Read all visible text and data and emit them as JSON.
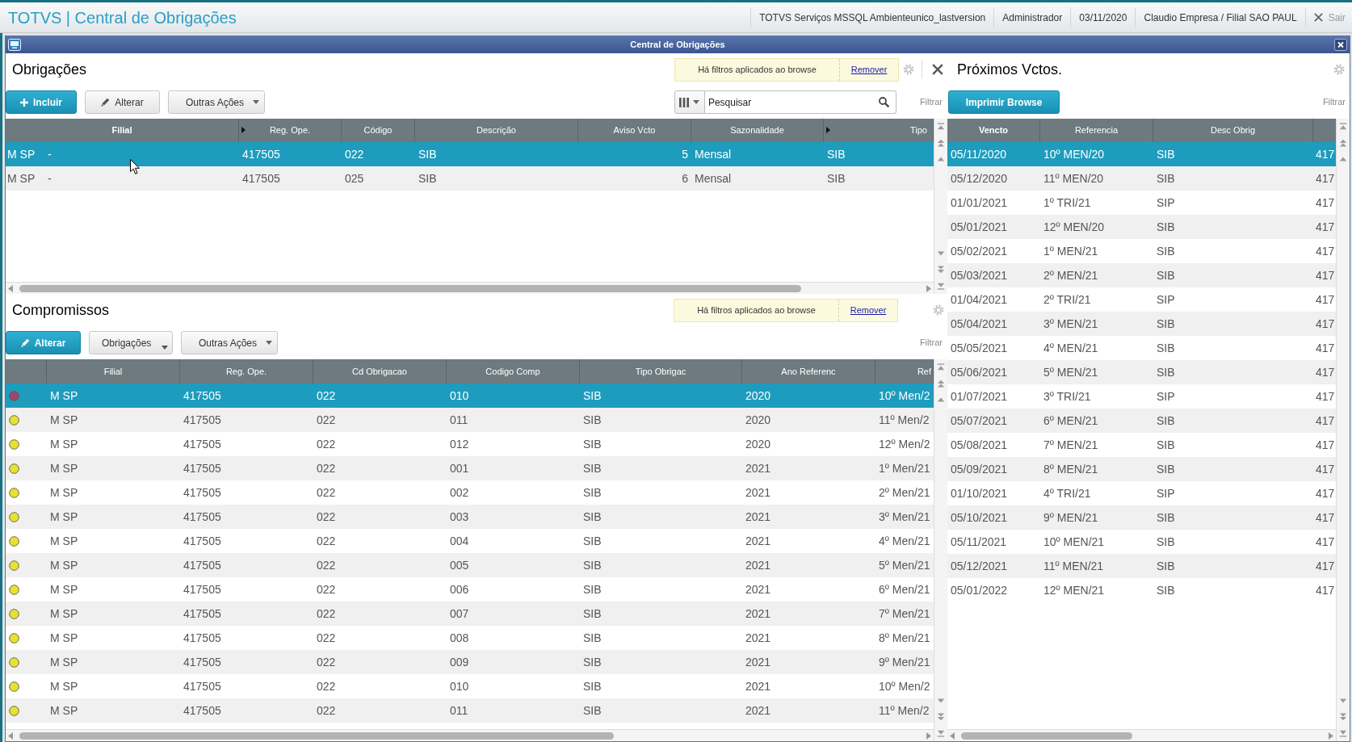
{
  "app_bar": {
    "title": "TOTVS | Central de Obrigações",
    "info": [
      "TOTVS Serviços MSSQL Ambienteunico_lastversion",
      "Administrador",
      "03/11/2020",
      "Claudio Empresa / Filial SAO PAUL"
    ],
    "exit": "Sair"
  },
  "window": {
    "title": "Central de Obrigações"
  },
  "obrigacoes": {
    "title": "Obrigações",
    "filter_notice": {
      "text": "Há filtros aplicados ao browse",
      "link": "Remover"
    },
    "buttons": [
      {
        "label": "Incluir",
        "kind": "add",
        "primary": true
      },
      {
        "label": "Alterar",
        "kind": "edit",
        "primary": false
      },
      {
        "label": "Outras Ações",
        "kind": "menu",
        "primary": false
      }
    ],
    "search": {
      "placeholder": "Pesquisar"
    },
    "filter_label": "Filtrar",
    "table": {
      "columns": [
        {
          "label": "Filial",
          "sorted": true,
          "arrow": false
        },
        {
          "label": "Reg. Ope.",
          "sorted": false,
          "arrow": true
        },
        {
          "label": "Código",
          "sorted": false,
          "arrow": false
        },
        {
          "label": "Descrição",
          "sorted": false,
          "arrow": false
        },
        {
          "label": "Aviso Vcto",
          "sorted": false,
          "arrow": false
        },
        {
          "label": "Sazonalidade",
          "sorted": false,
          "arrow": false
        },
        {
          "label": "Tipo",
          "sorted": false,
          "arrow": true
        }
      ],
      "rows": [
        {
          "selected": true,
          "cells": [
            [
              "M SP",
              "-"
            ],
            "417505",
            "022",
            "SIB",
            "5",
            "Mensal",
            "SIB"
          ]
        },
        {
          "selected": false,
          "cells": [
            [
              "M SP",
              "-"
            ],
            "417505",
            "025",
            "SIB",
            "6",
            "Mensal",
            "SIB"
          ]
        }
      ]
    }
  },
  "proximos_vctos": {
    "title": "Próximos Vctos.",
    "buttons": [
      {
        "label": "Imprimir Browse",
        "kind": "plain",
        "primary": true
      }
    ],
    "filter_label": "Filtrar",
    "table": {
      "columns": [
        {
          "label": "Vencto",
          "sorted": true
        },
        {
          "label": "Referencia",
          "sorted": false
        },
        {
          "label": "Desc Obrig",
          "sorted": false
        }
      ],
      "rows": [
        {
          "selected": true,
          "cells": [
            "05/11/2020",
            "10º MEN/20",
            "SIB",
            "417"
          ]
        },
        {
          "selected": false,
          "cells": [
            "05/12/2020",
            "11º MEN/20",
            "SIB",
            "417"
          ]
        },
        {
          "selected": false,
          "cells": [
            "01/01/2021",
            "1º TRI/21",
            "SIP",
            "417"
          ]
        },
        {
          "selected": false,
          "cells": [
            "05/01/2021",
            "12º MEN/20",
            "SIB",
            "417"
          ]
        },
        {
          "selected": false,
          "cells": [
            "05/02/2021",
            "1º MEN/21",
            "SIB",
            "417"
          ]
        },
        {
          "selected": false,
          "cells": [
            "05/03/2021",
            "2º MEN/21",
            "SIB",
            "417"
          ]
        },
        {
          "selected": false,
          "cells": [
            "01/04/2021",
            "2º TRI/21",
            "SIP",
            "417"
          ]
        },
        {
          "selected": false,
          "cells": [
            "05/04/2021",
            "3º MEN/21",
            "SIB",
            "417"
          ]
        },
        {
          "selected": false,
          "cells": [
            "05/05/2021",
            "4º MEN/21",
            "SIB",
            "417"
          ]
        },
        {
          "selected": false,
          "cells": [
            "05/06/2021",
            "5º MEN/21",
            "SIB",
            "417"
          ]
        },
        {
          "selected": false,
          "cells": [
            "01/07/2021",
            "3º TRI/21",
            "SIP",
            "417"
          ]
        },
        {
          "selected": false,
          "cells": [
            "05/07/2021",
            "6º MEN/21",
            "SIB",
            "417"
          ]
        },
        {
          "selected": false,
          "cells": [
            "05/08/2021",
            "7º MEN/21",
            "SIB",
            "417"
          ]
        },
        {
          "selected": false,
          "cells": [
            "05/09/2021",
            "8º MEN/21",
            "SIB",
            "417"
          ]
        },
        {
          "selected": false,
          "cells": [
            "01/10/2021",
            "4º TRI/21",
            "SIP",
            "417"
          ]
        },
        {
          "selected": false,
          "cells": [
            "05/10/2021",
            "9º MEN/21",
            "SIB",
            "417"
          ]
        },
        {
          "selected": false,
          "cells": [
            "05/11/2021",
            "10º MEN/21",
            "SIB",
            "417"
          ]
        },
        {
          "selected": false,
          "cells": [
            "05/12/2021",
            "11º MEN/21",
            "SIB",
            "417"
          ]
        },
        {
          "selected": false,
          "cells": [
            "05/01/2022",
            "12º MEN/21",
            "SIB",
            "417"
          ]
        }
      ]
    }
  },
  "compromissos": {
    "title": "Compromissos",
    "filter_notice": {
      "text": "Há filtros aplicados ao browse",
      "link": "Remover"
    },
    "buttons": [
      {
        "label": "Alterar",
        "kind": "edit",
        "primary": true
      },
      {
        "label": "Obrigações",
        "kind": "submenu",
        "primary": false
      },
      {
        "label": "Outras Ações",
        "kind": "menu",
        "primary": false
      }
    ],
    "filter_label": "Filtrar",
    "table": {
      "columns": [
        {
          "label": "Filial",
          "sorted": false
        },
        {
          "label": "Reg. Ope.",
          "sorted": false
        },
        {
          "label": "Cd Obrigacao",
          "sorted": false
        },
        {
          "label": "Codigo Comp",
          "sorted": false
        },
        {
          "label": "Tipo Obrigac",
          "sorted": false
        },
        {
          "label": "Ano Referenc",
          "sorted": false
        },
        {
          "label": "Ref",
          "sorted": false
        }
      ],
      "rows": [
        {
          "selected": true,
          "color": "#a0466e",
          "cells": [
            "M SP",
            "417505",
            "022",
            "010",
            "SIB",
            "2020",
            "10º Men/2"
          ]
        },
        {
          "selected": false,
          "color": "#e6e133",
          "cells": [
            "M SP",
            "417505",
            "022",
            "011",
            "SIB",
            "2020",
            "11º Men/2"
          ]
        },
        {
          "selected": false,
          "color": "#e6e133",
          "cells": [
            "M SP",
            "417505",
            "022",
            "012",
            "SIB",
            "2020",
            "12º Men/2"
          ]
        },
        {
          "selected": false,
          "color": "#e6e133",
          "cells": [
            "M SP",
            "417505",
            "022",
            "001",
            "SIB",
            "2021",
            "1º Men/21"
          ]
        },
        {
          "selected": false,
          "color": "#e6e133",
          "cells": [
            "M SP",
            "417505",
            "022",
            "002",
            "SIB",
            "2021",
            "2º Men/21"
          ]
        },
        {
          "selected": false,
          "color": "#e6e133",
          "cells": [
            "M SP",
            "417505",
            "022",
            "003",
            "SIB",
            "2021",
            "3º Men/21"
          ]
        },
        {
          "selected": false,
          "color": "#e6e133",
          "cells": [
            "M SP",
            "417505",
            "022",
            "004",
            "SIB",
            "2021",
            "4º Men/21"
          ]
        },
        {
          "selected": false,
          "color": "#e6e133",
          "cells": [
            "M SP",
            "417505",
            "022",
            "005",
            "SIB",
            "2021",
            "5º Men/21"
          ]
        },
        {
          "selected": false,
          "color": "#e6e133",
          "cells": [
            "M SP",
            "417505",
            "022",
            "006",
            "SIB",
            "2021",
            "6º Men/21"
          ]
        },
        {
          "selected": false,
          "color": "#e6e133",
          "cells": [
            "M SP",
            "417505",
            "022",
            "007",
            "SIB",
            "2021",
            "7º Men/21"
          ]
        },
        {
          "selected": false,
          "color": "#e6e133",
          "cells": [
            "M SP",
            "417505",
            "022",
            "008",
            "SIB",
            "2021",
            "8º Men/21"
          ]
        },
        {
          "selected": false,
          "color": "#e6e133",
          "cells": [
            "M SP",
            "417505",
            "022",
            "009",
            "SIB",
            "2021",
            "9º Men/21"
          ]
        },
        {
          "selected": false,
          "color": "#e6e133",
          "cells": [
            "M SP",
            "417505",
            "022",
            "010",
            "SIB",
            "2021",
            "10º Men/2"
          ]
        },
        {
          "selected": false,
          "color": "#e6e133",
          "cells": [
            "M SP",
            "417505",
            "022",
            "011",
            "SIB",
            "2021",
            "11º Men/2"
          ]
        }
      ]
    }
  }
}
